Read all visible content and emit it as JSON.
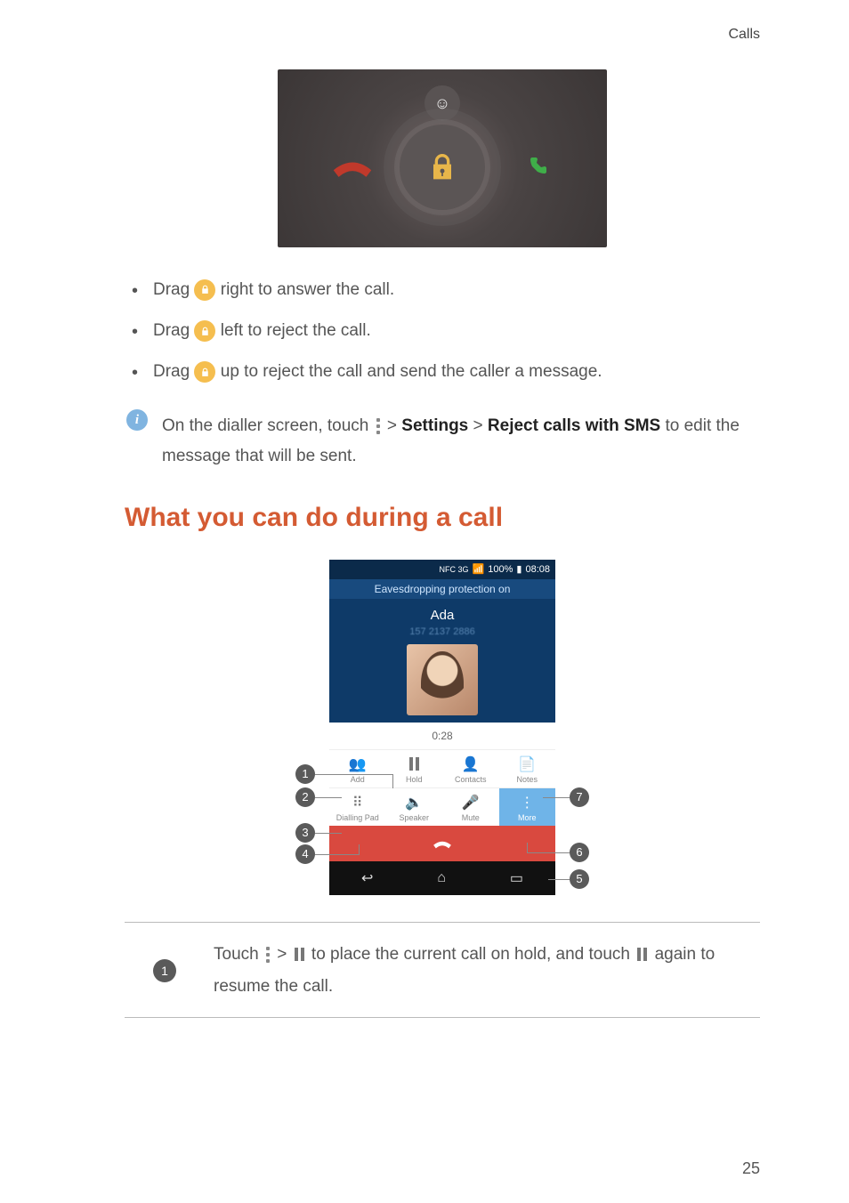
{
  "header": {
    "section": "Calls"
  },
  "bullets": {
    "b1a": "Drag ",
    "b1b": " right to answer the call.",
    "b2a": "Drag ",
    "b2b": " left to reject the call.",
    "b3a": "Drag ",
    "b3b": " up to reject the call and send the caller a message."
  },
  "info": {
    "pre": "On the dialler screen, touch ",
    "gt1": " > ",
    "settings": "Settings",
    "gt2": " > ",
    "reject": "Reject calls with SMS",
    "post": " to edit the message that will be sent."
  },
  "section_title": "What you can do during a call",
  "phone": {
    "status": {
      "net": "NFC 3G",
      "sig": "100%",
      "time": "08:08"
    },
    "eavesdrop": "Eavesdropping protection on",
    "name": "Ada",
    "number": "157 2137 2886",
    "timer": "0:28",
    "row1": {
      "add": "Add",
      "hold": "Hold",
      "contacts": "Contacts",
      "notes": "Notes"
    },
    "row2": {
      "pad": "Dialling Pad",
      "speaker": "Speaker",
      "mute": "Mute",
      "more": "More"
    }
  },
  "callouts": {
    "c1": "1",
    "c2": "2",
    "c3": "3",
    "c4": "4",
    "c5": "5",
    "c6": "6",
    "c7": "7"
  },
  "table": {
    "n1": "1",
    "t1a": "Touch ",
    "t1b": " > ",
    "t1c": " to place the current call on hold, and touch ",
    "t1d": " again to resume the call."
  },
  "page": "25"
}
